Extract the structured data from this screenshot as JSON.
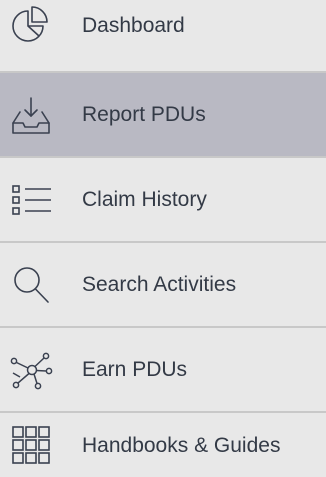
{
  "nav": {
    "items": [
      {
        "label": "Dashboard",
        "icon": "pie-chart-icon",
        "active": false
      },
      {
        "label": "Report PDUs",
        "icon": "inbox-download-icon",
        "active": true
      },
      {
        "label": "Claim History",
        "icon": "list-icon",
        "active": false
      },
      {
        "label": "Search Activities",
        "icon": "search-icon",
        "active": false
      },
      {
        "label": "Earn PDUs",
        "icon": "network-icon",
        "active": false
      },
      {
        "label": "Handbooks & Guides",
        "icon": "grid-icon",
        "active": false
      }
    ]
  },
  "colors": {
    "background": "#e8e8e8",
    "active_background": "#b9b9c3",
    "divider": "#c8c8c8",
    "text": "#333a46",
    "icon": "#3a4150"
  }
}
